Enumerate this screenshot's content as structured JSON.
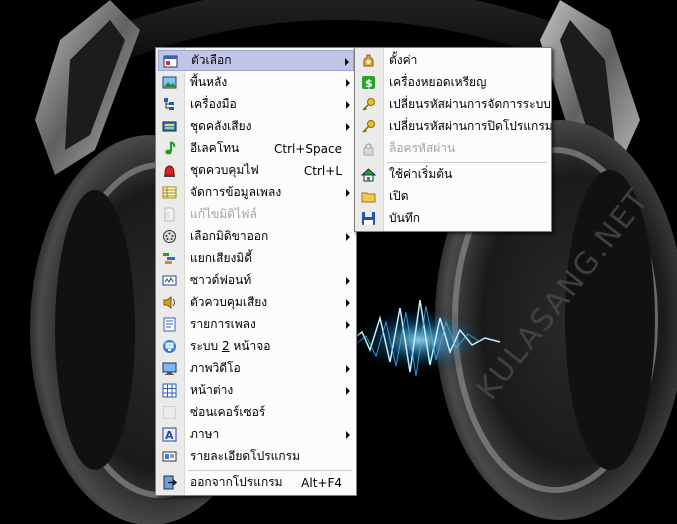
{
  "watermark": "KULASANG.NET",
  "main_menu": {
    "items": [
      {
        "label": "ตัวเลือก",
        "icon": "options-icon",
        "submenu": true
      },
      {
        "label": "พื้นหลัง",
        "icon": "background-icon",
        "submenu": true
      },
      {
        "label": "เครื่องมือ",
        "icon": "tools-icon",
        "submenu": true
      },
      {
        "label": "ชุดคลังเสียง",
        "icon": "sound-bank-icon",
        "submenu": true
      },
      {
        "label": "อีเลคโทน",
        "icon": "music-note-icon",
        "shortcut": "Ctrl+Space"
      },
      {
        "label": "ชุดควบคุมไฟ",
        "icon": "light-control-icon",
        "shortcut": "Ctrl+L"
      },
      {
        "label": "จัดการข้อมูลเพลง",
        "icon": "song-data-icon",
        "submenu": true
      },
      {
        "label": "แก้ไขมิดิไฟล์",
        "icon": "midi-file-icon",
        "disabled": true
      },
      {
        "label": "เลือกมิดิขาออก",
        "icon": "midi-out-icon",
        "submenu": true
      },
      {
        "label": "แยกเสียงมิดี้",
        "icon": "midi-split-icon"
      },
      {
        "label": "ซาวด์ฟอนท์",
        "icon": "soundfont-icon",
        "submenu": true
      },
      {
        "label": "ตัวควบคุมเสียง",
        "icon": "speaker-icon",
        "submenu": true
      },
      {
        "label": "รายการเพลง",
        "icon": "playlist-icon",
        "submenu": true
      },
      {
        "label_prefix": "ระบบ ",
        "label_underline": "2",
        "label_suffix": " หน้าจอ",
        "icon": "dual-screen-icon"
      },
      {
        "label": "ภาพวิดีโอ",
        "icon": "video-icon",
        "submenu": true
      },
      {
        "label": "หน้าต่าง",
        "icon": "window-icon",
        "submenu": true
      },
      {
        "label": "ซ่อนเคอร์เซอร์",
        "icon": "cursor-icon"
      },
      {
        "label": "ภาษา",
        "icon": "language-icon",
        "submenu": true
      },
      {
        "label": "รายละเอียดโปรแกรม",
        "icon": "about-icon"
      },
      {
        "label": "ออกจากโปรแกรม",
        "icon": "exit-icon",
        "shortcut": "Alt+F4"
      }
    ]
  },
  "sub_menu": {
    "items": [
      {
        "label": "ตั้งค่า",
        "icon": "settings-icon"
      },
      {
        "label": "เครื่องหยอดเหรียญ",
        "icon": "coin-machine-icon"
      },
      {
        "label": "เปลี่ยนรหัสผ่านการจัดการระบบ",
        "icon": "key-icon"
      },
      {
        "label": "เปลี่ยนรหัสผ่านการปิดโปรแกรม",
        "icon": "key-icon"
      },
      {
        "label": "ล็อครหัสผ่าน",
        "icon": "lock-icon",
        "disabled": true
      },
      {
        "label": "ใช้ค่าเริ่มต้น",
        "icon": "home-icon"
      },
      {
        "label": "เปิด",
        "icon": "open-folder-icon"
      },
      {
        "label": "บันทึก",
        "icon": "save-icon"
      }
    ]
  }
}
